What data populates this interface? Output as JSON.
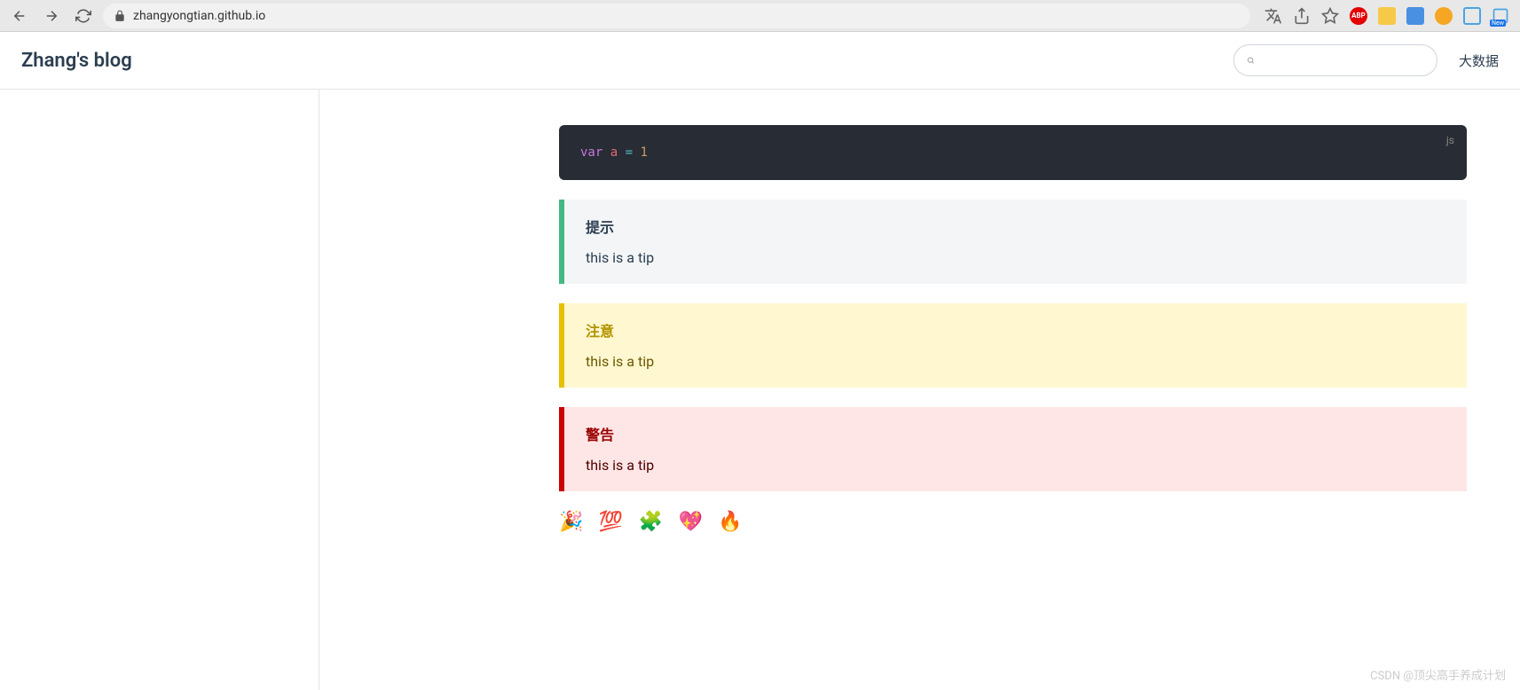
{
  "browser": {
    "url": "zhangyongtian.github.io",
    "new_badge": "New"
  },
  "header": {
    "title": "Zhang's blog",
    "search_placeholder": "",
    "nav_link": "大数据"
  },
  "code": {
    "lang": "js",
    "tokens": {
      "keyword": "var",
      "identifier": "a",
      "operator": "=",
      "number": "1"
    }
  },
  "blocks": [
    {
      "type": "tip",
      "title": "提示",
      "body": "this is a tip"
    },
    {
      "type": "warning",
      "title": "注意",
      "body": "this is a tip"
    },
    {
      "type": "danger",
      "title": "警告",
      "body": "this is a tip"
    }
  ],
  "emoji_row": "🎉 💯 🧩 💖 🔥",
  "watermark": "CSDN @顶尖高手养成计划"
}
